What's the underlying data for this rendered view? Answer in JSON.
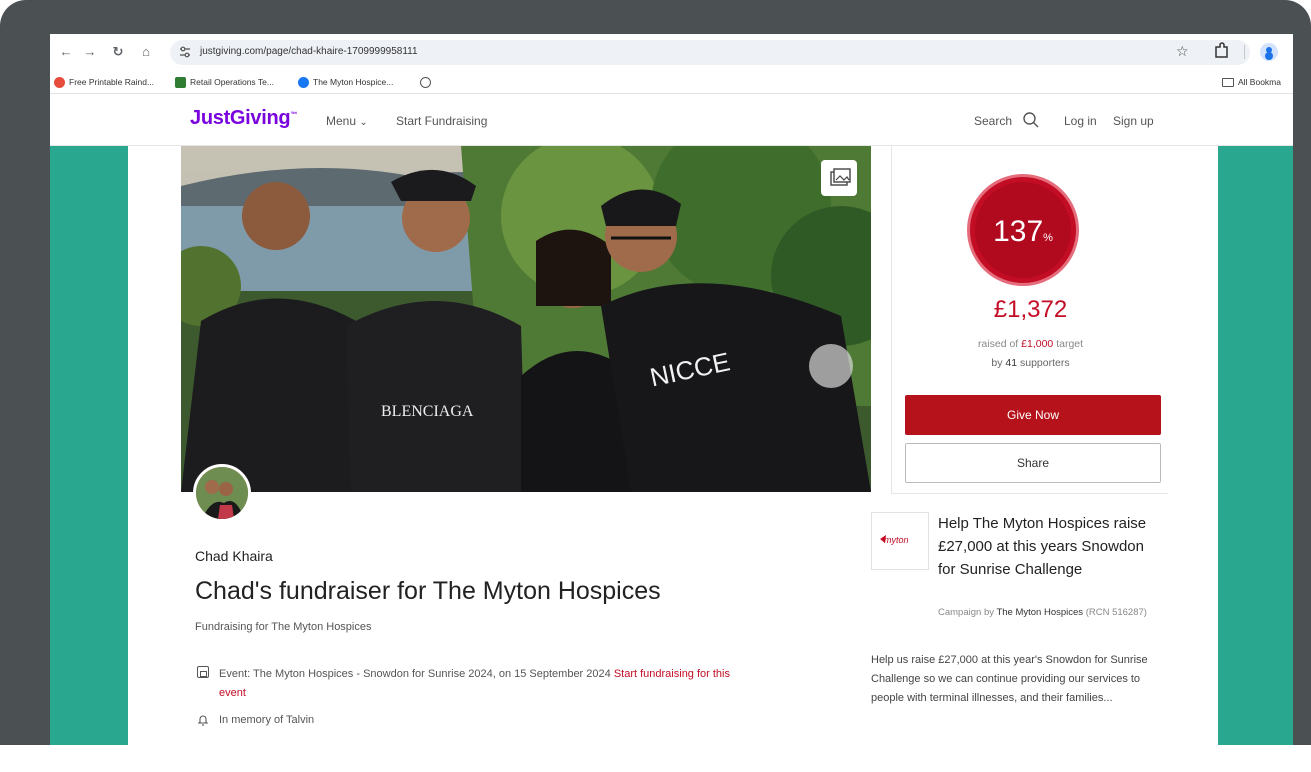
{
  "browser": {
    "url": "justgiving.com/page/chad-khaire-1709999958111",
    "bookmarks": [
      {
        "label": "Free Printable Raind...",
        "color": "#e74c3c"
      },
      {
        "label": "Retail Operations Te...",
        "color": "#2e7d32"
      },
      {
        "label": "The Myton Hospice...",
        "color": "#1877f2"
      },
      {
        "label": "",
        "color": "#555555"
      }
    ],
    "all_bookmarks": "All Bookma"
  },
  "site": {
    "logo": "JustGiving",
    "nav": {
      "menu": "Menu",
      "start": "Start Fundraising",
      "search": "Search",
      "login": "Log in",
      "signup": "Sign up"
    }
  },
  "fundraiser": {
    "owner": "Chad Khaira",
    "title": "Chad's fundraiser for The Myton Hospices",
    "subtitle": "Fundraising for The Myton Hospices",
    "event_text": "Event: The Myton Hospices - Snowdon for Sunrise 2024, on 15 September 2024",
    "event_link": "Start fundraising for this event",
    "memory": "In memory of Talvin"
  },
  "donation": {
    "percent": "137",
    "percent_symbol": "%",
    "progress_fraction": 1.37,
    "raised": "£1,372",
    "target_prefix": "raised of",
    "target_amount": "£1,000",
    "target_suffix": "target",
    "by": "by",
    "supporters_count": "41",
    "supporters_label": "supporters",
    "give_label": "Give Now",
    "share_label": "Share"
  },
  "campaign": {
    "logo_text": "myton",
    "title": "Help The Myton Hospices raise £27,000 at this years Snowdon for Sunrise Challenge",
    "by_prefix": "Campaign by",
    "by_name": "The Myton Hospices",
    "rcn": "(RCN 516287)",
    "description": "Help us raise £27,000 at this year's Snowdon for Sunrise Challenge so we can continue providing our services to people with terminal illnesses, and their families..."
  },
  "colors": {
    "brand": "#7a04dd",
    "accent": "#c30d25",
    "page_bg": "#2aa88f"
  }
}
